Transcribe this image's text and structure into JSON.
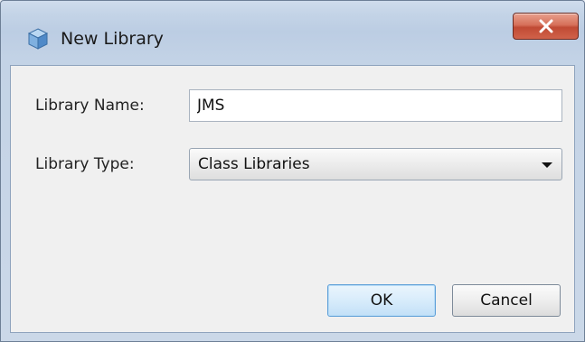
{
  "window": {
    "title": "New Library",
    "app_icon": "netbeans-cube-icon",
    "close_icon": "close-icon",
    "close_color": "#c8503a"
  },
  "form": {
    "library_name": {
      "label": "Library Name:",
      "value": "JMS"
    },
    "library_type": {
      "label": "Library Type:",
      "selected": "Class Libraries",
      "dropdown_icon": "chevron-down-icon"
    }
  },
  "buttons": {
    "ok": "OK",
    "cancel": "Cancel",
    "default_accent": "#5fa0d8"
  }
}
